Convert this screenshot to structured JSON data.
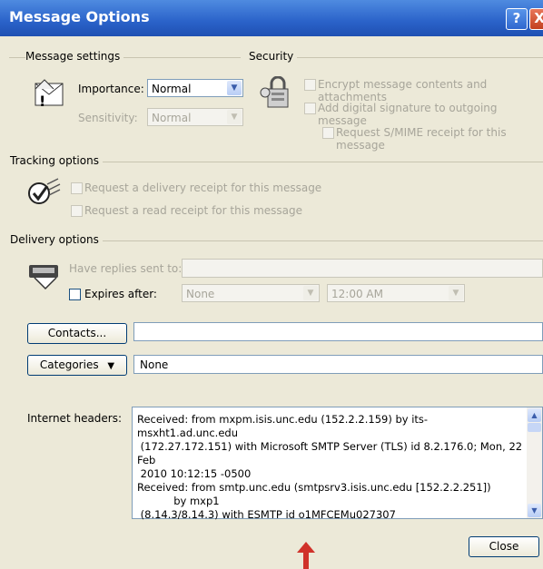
{
  "window": {
    "title": "Message Options",
    "help_label": "?",
    "close_label": "X"
  },
  "message_settings": {
    "title": "Message settings",
    "importance_label": "Importance:",
    "importance_value": "Normal",
    "sensitivity_label": "Sensitivity:",
    "sensitivity_value": "Normal"
  },
  "security": {
    "title": "Security",
    "encrypt_label": "Encrypt message contents and attachments",
    "signature_label": "Add digital signature to outgoing message",
    "smime_label": "Request S/MIME receipt for this message"
  },
  "tracking": {
    "title": "Tracking options",
    "delivery_receipt_label": "Request a delivery receipt for this message",
    "read_receipt_label": "Request a read receipt for this message"
  },
  "delivery": {
    "title": "Delivery options",
    "replies_label": "Have replies sent to:",
    "expires_label": "Expires after:",
    "expires_date": "None",
    "expires_time": "12:00 AM"
  },
  "contacts_button": "Contacts...",
  "categories_button": "Categories",
  "categories_value": "None",
  "internet_headers": {
    "label": "Internet headers:",
    "text": "Received: from mxpm.isis.unc.edu (152.2.2.159) by its-msxht1.ad.unc.edu\n (172.27.172.151) with Microsoft SMTP Server (TLS) id 8.2.176.0; Mon, 22\nFeb\n 2010 10:12:15 -0500\nReceived: from smtp.unc.edu (smtpsrv3.isis.unc.edu [152.2.2.251])\n           by mxp1\n (8.14.3/8.14.3) with ESMTP id o1MFCEMu027307"
  },
  "close_button": "Close",
  "colors": {
    "titlebar": "#2a62c9",
    "dialog_bg": "#ece9d8",
    "annotation_arrow": "#d0322a"
  }
}
